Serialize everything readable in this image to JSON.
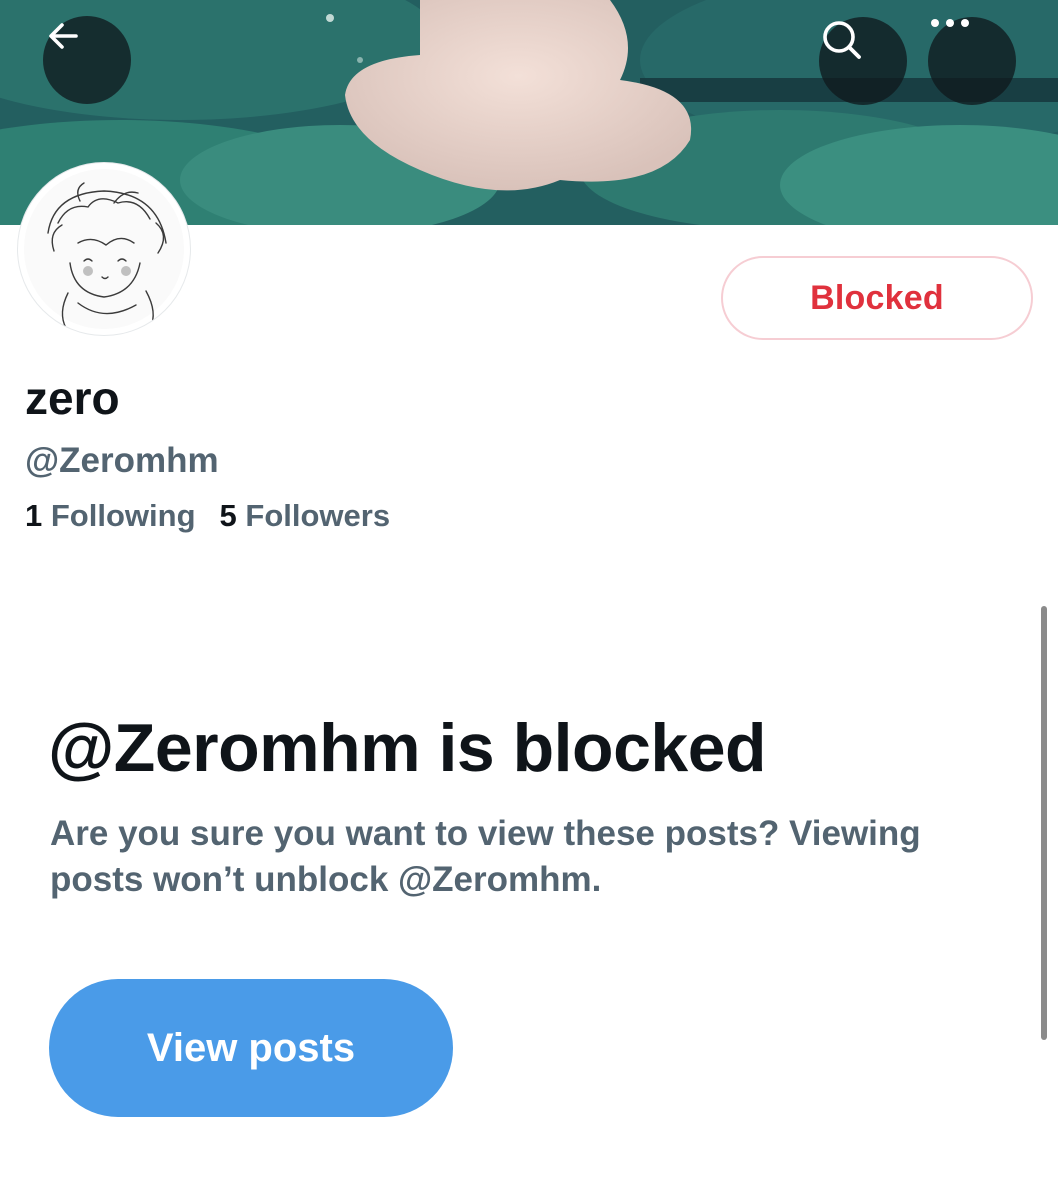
{
  "header": {
    "back_icon": "arrow-left-icon",
    "search_icon": "search-icon",
    "more_icon": "more-horizontal-icon"
  },
  "profile": {
    "display_name": "zero",
    "handle": "@Zeromhm",
    "following_count": "1",
    "following_label": "Following",
    "followers_count": "5",
    "followers_label": "Followers",
    "blocked_button_label": "Blocked"
  },
  "blocked_notice": {
    "title": "@Zeromhm is blocked",
    "description": "Are you sure you want to view these posts? Viewing posts won’t unblock @Zeromhm.",
    "view_posts_label": "View posts"
  },
  "colors": {
    "blocked_red": "#e0313d",
    "primary_blue": "#4a9be8",
    "text_primary": "#0f1419",
    "text_secondary": "#536471"
  }
}
